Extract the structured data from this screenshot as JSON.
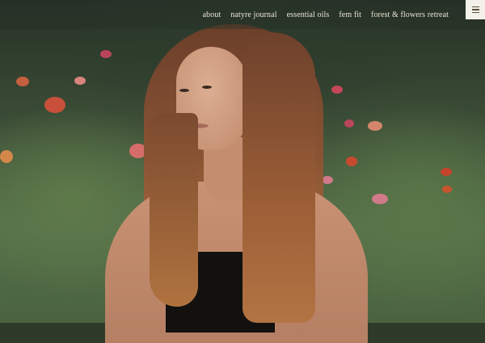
{
  "nav": {
    "items": [
      {
        "label": "about"
      },
      {
        "label": "natyre journal"
      },
      {
        "label": "essential oils"
      },
      {
        "label": "fem fit"
      },
      {
        "label": "forest & flowers retreat"
      }
    ]
  },
  "menu_button": {
    "icon": "hamburger-menu-icon"
  },
  "colors": {
    "nav_text": "#e9e4d6",
    "menu_button_bg": "#f4f1ea",
    "foliage": "#55704a",
    "flower_accent": "#c8503a"
  }
}
